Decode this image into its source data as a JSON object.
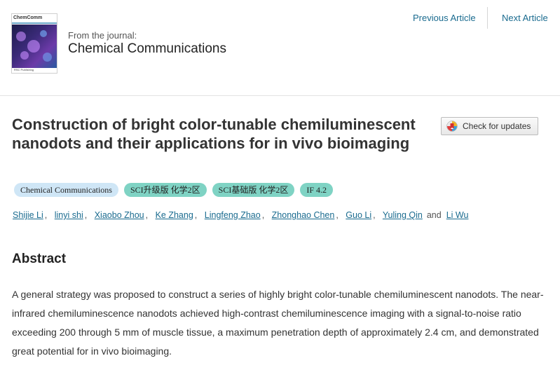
{
  "cover": {
    "title": "ChemComm",
    "footer": "RSC Publishing"
  },
  "journal": {
    "from_label": "From the journal:",
    "name": "Chemical Communications"
  },
  "nav": {
    "previous": "Previous Article",
    "next": "Next Article"
  },
  "article": {
    "title": "Construction of bright color-tunable chemiluminescent nanodots and their applications for in vivo bioimaging"
  },
  "check_updates": {
    "label": "Check for updates",
    "icon": "crossmark-icon"
  },
  "tags": [
    {
      "label": "Chemical Communications",
      "color": "#cfe6f6"
    },
    {
      "label": "SCI升级版 化学2区",
      "color": "#7fd3c4"
    },
    {
      "label": "SCI基础版 化学2区",
      "color": "#7fd3c4"
    },
    {
      "label": "IF 4.2",
      "color": "#7fd3c4"
    }
  ],
  "authors": {
    "names": [
      "Shijie Li",
      "linyi shi",
      "Xiaobo Zhou",
      "Ke Zhang",
      "Lingfeng Zhao",
      "Zhonghao Chen",
      "Guo Li",
      "Yuling Qin",
      "Li Wu"
    ],
    "separator": ",",
    "conjunction": "and"
  },
  "abstract": {
    "heading": "Abstract",
    "text": "A general strategy was proposed to construct a series of highly bright color-tunable chemiluminescent nanodots. The near-infrared chemiluminescence nanodots achieved high-contrast chemiluminescence imaging with a signal-to-noise ratio exceeding 200 through 5 mm of muscle tissue, a maximum penetration depth of approximately 2.4 cm, and demonstrated great potential for in vivo bioimaging."
  },
  "colors": {
    "link": "#1a6b8f",
    "tag_blue": "#cfe6f6",
    "tag_teal": "#7fd3c4"
  }
}
